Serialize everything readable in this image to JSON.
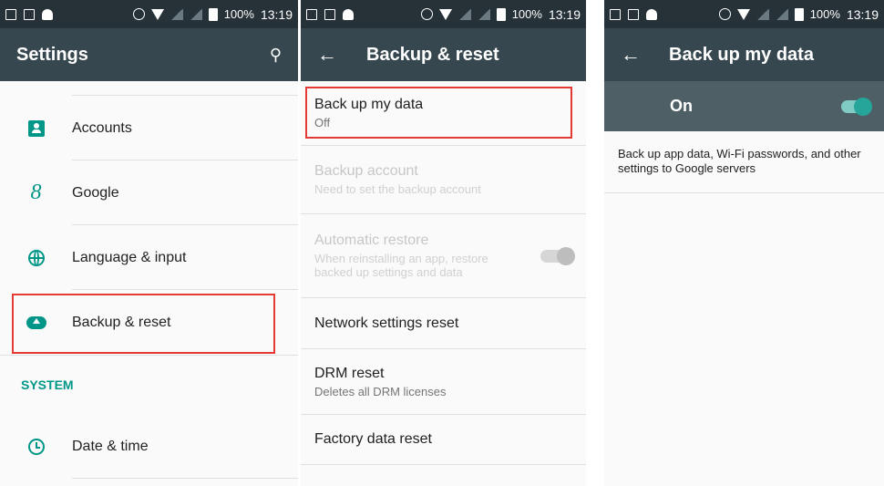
{
  "status_bar": {
    "battery": "100%",
    "time": "13:19"
  },
  "panel1": {
    "title": "Settings",
    "items": [
      {
        "label": "Accounts",
        "icon": "account-box-icon"
      },
      {
        "label": "Google",
        "icon": "google-icon"
      },
      {
        "label": "Language & input",
        "icon": "globe-icon"
      },
      {
        "label": "Backup & reset",
        "icon": "cloud-upload-icon"
      }
    ],
    "section": "SYSTEM",
    "system_items": [
      {
        "label": "Date & time",
        "icon": "clock-icon"
      }
    ]
  },
  "panel2": {
    "title": "Backup & reset",
    "items": [
      {
        "title": "Back up my data",
        "summary": "Off",
        "enabled": true
      },
      {
        "title": "Backup account",
        "summary": "Need to set the backup account",
        "enabled": false
      },
      {
        "title": "Automatic restore",
        "summary": "When reinstalling an app, restore backed up settings and data",
        "enabled": false
      },
      {
        "title": "Network settings reset"
      },
      {
        "title": "DRM reset",
        "summary": "Deletes all DRM licenses"
      },
      {
        "title": "Factory data reset"
      }
    ]
  },
  "panel3": {
    "title": "Back up my data",
    "switch_label": "On",
    "description": "Back up app data, Wi-Fi passwords, and other settings to Google servers"
  },
  "colors": {
    "accent": "#009688",
    "toolbar": "#37474f",
    "statusbar": "#263238",
    "highlight": "#e53935"
  }
}
